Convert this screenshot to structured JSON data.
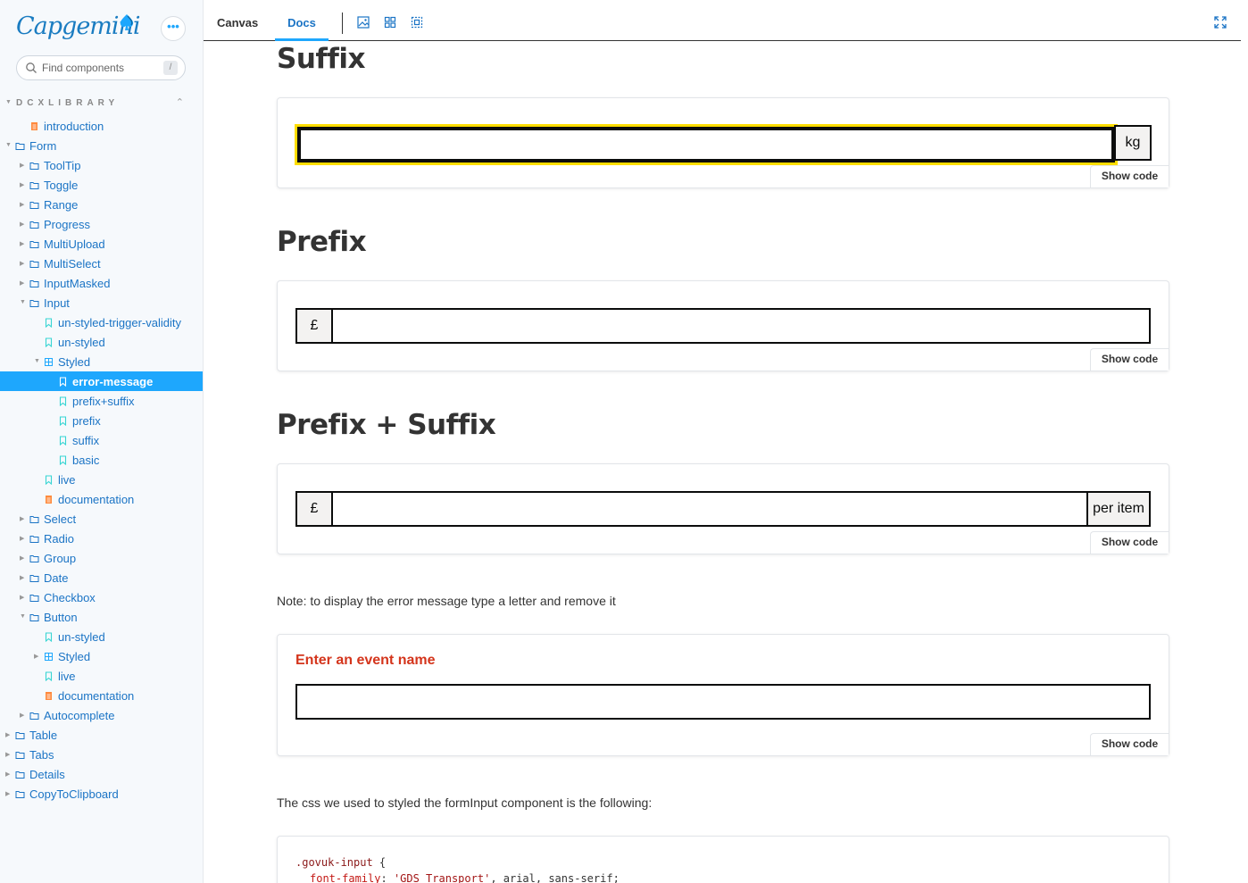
{
  "sidebar": {
    "logo": "Capgemini",
    "menu_label": "•••",
    "search": {
      "placeholder": "Find components",
      "shortcut": "/"
    },
    "library": "DCXLIBRARY",
    "tree": [
      {
        "label": "introduction",
        "type": "doc",
        "depth": 1,
        "twisty": ""
      },
      {
        "label": "Form",
        "type": "folder",
        "depth": 0,
        "twisty": "open"
      },
      {
        "label": "ToolTip",
        "type": "folder",
        "depth": 1,
        "twisty": "closed"
      },
      {
        "label": "Toggle",
        "type": "folder",
        "depth": 1,
        "twisty": "closed"
      },
      {
        "label": "Range",
        "type": "folder",
        "depth": 1,
        "twisty": "closed"
      },
      {
        "label": "Progress",
        "type": "folder",
        "depth": 1,
        "twisty": "closed"
      },
      {
        "label": "MultiUpload",
        "type": "folder",
        "depth": 1,
        "twisty": "closed"
      },
      {
        "label": "MultiSelect",
        "type": "folder",
        "depth": 1,
        "twisty": "closed"
      },
      {
        "label": "InputMasked",
        "type": "folder",
        "depth": 1,
        "twisty": "closed"
      },
      {
        "label": "Input",
        "type": "folder",
        "depth": 1,
        "twisty": "open"
      },
      {
        "label": "un-styled-trigger-validity",
        "type": "story",
        "depth": 2,
        "twisty": ""
      },
      {
        "label": "un-styled",
        "type": "story",
        "depth": 2,
        "twisty": ""
      },
      {
        "label": "Styled",
        "type": "component",
        "depth": 2,
        "twisty": "open"
      },
      {
        "label": "error-message",
        "type": "story",
        "depth": 3,
        "twisty": "",
        "selected": true
      },
      {
        "label": "prefix+suffix",
        "type": "story",
        "depth": 3,
        "twisty": ""
      },
      {
        "label": "prefix",
        "type": "story",
        "depth": 3,
        "twisty": ""
      },
      {
        "label": "suffix",
        "type": "story",
        "depth": 3,
        "twisty": ""
      },
      {
        "label": "basic",
        "type": "story",
        "depth": 3,
        "twisty": ""
      },
      {
        "label": "live",
        "type": "story",
        "depth": 2,
        "twisty": ""
      },
      {
        "label": "documentation",
        "type": "doc",
        "depth": 2,
        "twisty": ""
      },
      {
        "label": "Select",
        "type": "folder",
        "depth": 1,
        "twisty": "closed"
      },
      {
        "label": "Radio",
        "type": "folder",
        "depth": 1,
        "twisty": "closed"
      },
      {
        "label": "Group",
        "type": "folder",
        "depth": 1,
        "twisty": "closed"
      },
      {
        "label": "Date",
        "type": "folder",
        "depth": 1,
        "twisty": "closed"
      },
      {
        "label": "Checkbox",
        "type": "folder",
        "depth": 1,
        "twisty": "closed"
      },
      {
        "label": "Button",
        "type": "folder",
        "depth": 1,
        "twisty": "open"
      },
      {
        "label": "un-styled",
        "type": "story",
        "depth": 2,
        "twisty": ""
      },
      {
        "label": "Styled",
        "type": "component",
        "depth": 2,
        "twisty": "closed"
      },
      {
        "label": "live",
        "type": "story",
        "depth": 2,
        "twisty": ""
      },
      {
        "label": "documentation",
        "type": "doc",
        "depth": 2,
        "twisty": ""
      },
      {
        "label": "Autocomplete",
        "type": "folder",
        "depth": 1,
        "twisty": "closed"
      },
      {
        "label": "Table",
        "type": "folder",
        "depth": 0,
        "twisty": "closed"
      },
      {
        "label": "Tabs",
        "type": "folder",
        "depth": 0,
        "twisty": "closed"
      },
      {
        "label": "Details",
        "type": "folder",
        "depth": 0,
        "twisty": "closed"
      },
      {
        "label": "CopyToClipboard",
        "type": "folder",
        "depth": 0,
        "twisty": "closed"
      }
    ]
  },
  "toolbar": {
    "tabs": [
      "Canvas",
      "Docs"
    ],
    "active_tab": "Docs",
    "tools": [
      "image-icon",
      "grid-icon",
      "outline-icon"
    ],
    "fullscreen": "fullscreen-icon"
  },
  "main": {
    "suffix": {
      "title": "Suffix",
      "suffix_text": "kg",
      "show_code": "Show code"
    },
    "prefix": {
      "title": "Prefix",
      "prefix_text": "£",
      "show_code": "Show code"
    },
    "prefix_suffix": {
      "title": "Prefix + Suffix",
      "prefix_text": "£",
      "suffix_text": "per item",
      "show_code": "Show code"
    },
    "note": "Note: to display the error message type a letter and remove it",
    "error": {
      "label": "Enter an event name",
      "show_code": "Show code"
    },
    "css_note": "The css we used to styled the formInput component is the following:",
    "code_line1_selector": ".govuk-input",
    "code_line1_brace": " {",
    "code_line2_prop": "font-family",
    "code_line2_colon": ": ",
    "code_line2_str": "'GDS Transport'",
    "code_line2_rest": ", arial, sans-serif;"
  },
  "colors": {
    "accent": "#1ea7fd",
    "link": "#1b74c5",
    "focus_yellow": "#ffdd00",
    "error_red": "#d4351c",
    "input_border": "#0b0c0c"
  }
}
